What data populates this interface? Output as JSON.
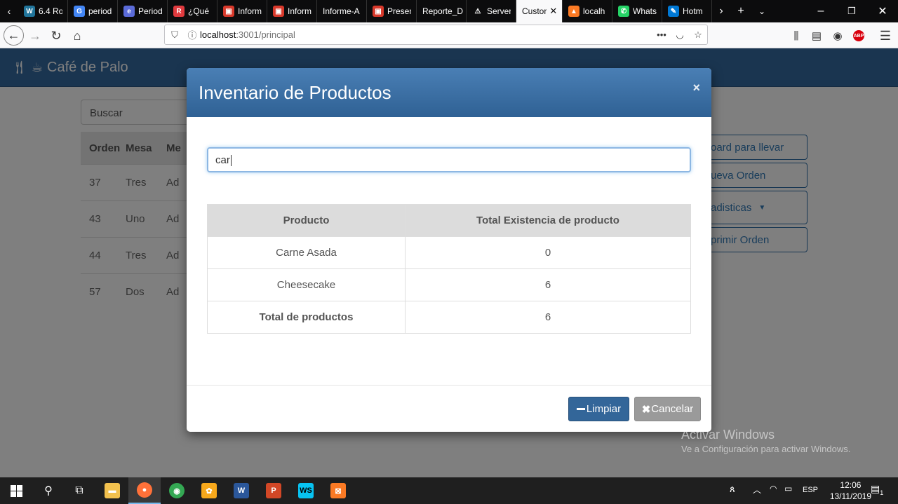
{
  "browser": {
    "tabs": [
      {
        "label": "6.4 Ro",
        "icon": "wordpress-icon",
        "color": "#21759b",
        "glyph": "W"
      },
      {
        "label": "period",
        "icon": "google-icon",
        "color": "#4285f4",
        "glyph": "G"
      },
      {
        "label": "Period",
        "icon": "generic-site-icon",
        "color": "#5b6bd9",
        "glyph": "e"
      },
      {
        "label": "¿Qué",
        "icon": "redbubble-icon",
        "color": "#e03a3e",
        "glyph": "R"
      },
      {
        "label": "Inform",
        "icon": "pdf-icon",
        "color": "#d8392b",
        "glyph": "▣"
      },
      {
        "label": "Inform",
        "icon": "pdf-icon",
        "color": "#d8392b",
        "glyph": "▣"
      },
      {
        "label": "Informe-A",
        "icon": "",
        "color": "",
        "glyph": ""
      },
      {
        "label": "Presen",
        "icon": "pdf-icon",
        "color": "#d8392b",
        "glyph": "▣"
      },
      {
        "label": "Reporte_D",
        "icon": "",
        "color": "",
        "glyph": ""
      },
      {
        "label": "Server",
        "icon": "warning-icon",
        "color": "#0c0c0d",
        "glyph": "⚠"
      },
      {
        "label": "Custor",
        "icon": "",
        "color": "",
        "glyph": "",
        "active": true
      },
      {
        "label": "localh",
        "icon": "xampp-icon",
        "color": "#fb7a24",
        "glyph": "▲"
      },
      {
        "label": "Whats",
        "icon": "whatsapp-icon",
        "color": "#25d366",
        "glyph": "✆"
      },
      {
        "label": "Hotm",
        "icon": "outlook-icon",
        "color": "#0078d4",
        "glyph": "✎"
      }
    ],
    "url_host": "localhost",
    "url_path": ":3001/principal"
  },
  "app": {
    "brand": "Café de Palo",
    "search_placeholder": "Buscar",
    "orders_table": {
      "headers": [
        "Orden",
        "Mesa",
        "Me"
      ],
      "rows": [
        [
          "37",
          "Tres",
          "Ad"
        ],
        [
          "43",
          "Uno",
          "Ad"
        ],
        [
          "44",
          "Tres",
          "Ad"
        ],
        [
          "57",
          "Dos",
          "Ad"
        ]
      ]
    },
    "side_buttons": [
      "oard para llevar",
      "ueva Orden",
      "adisticas",
      "primir Orden"
    ]
  },
  "modal": {
    "title": "Inventario de Productos",
    "close": "×",
    "search_value": "car",
    "table": {
      "headers": [
        "Producto",
        "Total Existencia de producto"
      ],
      "rows": [
        [
          "Carne Asada",
          "0"
        ],
        [
          "Cheesecake",
          "6"
        ]
      ],
      "total_label": "Total de productos",
      "total_value": "6"
    },
    "btn_clear": "Limpiar",
    "btn_cancel": "Cancelar",
    "clear_icon": "minus-icon",
    "cancel_icon": "x-icon"
  },
  "watermark": {
    "line1": "Activar Windows",
    "line2": "Ve a Configuración para activar Windows."
  },
  "taskbar": {
    "lang": "ESP",
    "time": "12:06",
    "date": "13/11/2019",
    "notif_count": "1"
  }
}
